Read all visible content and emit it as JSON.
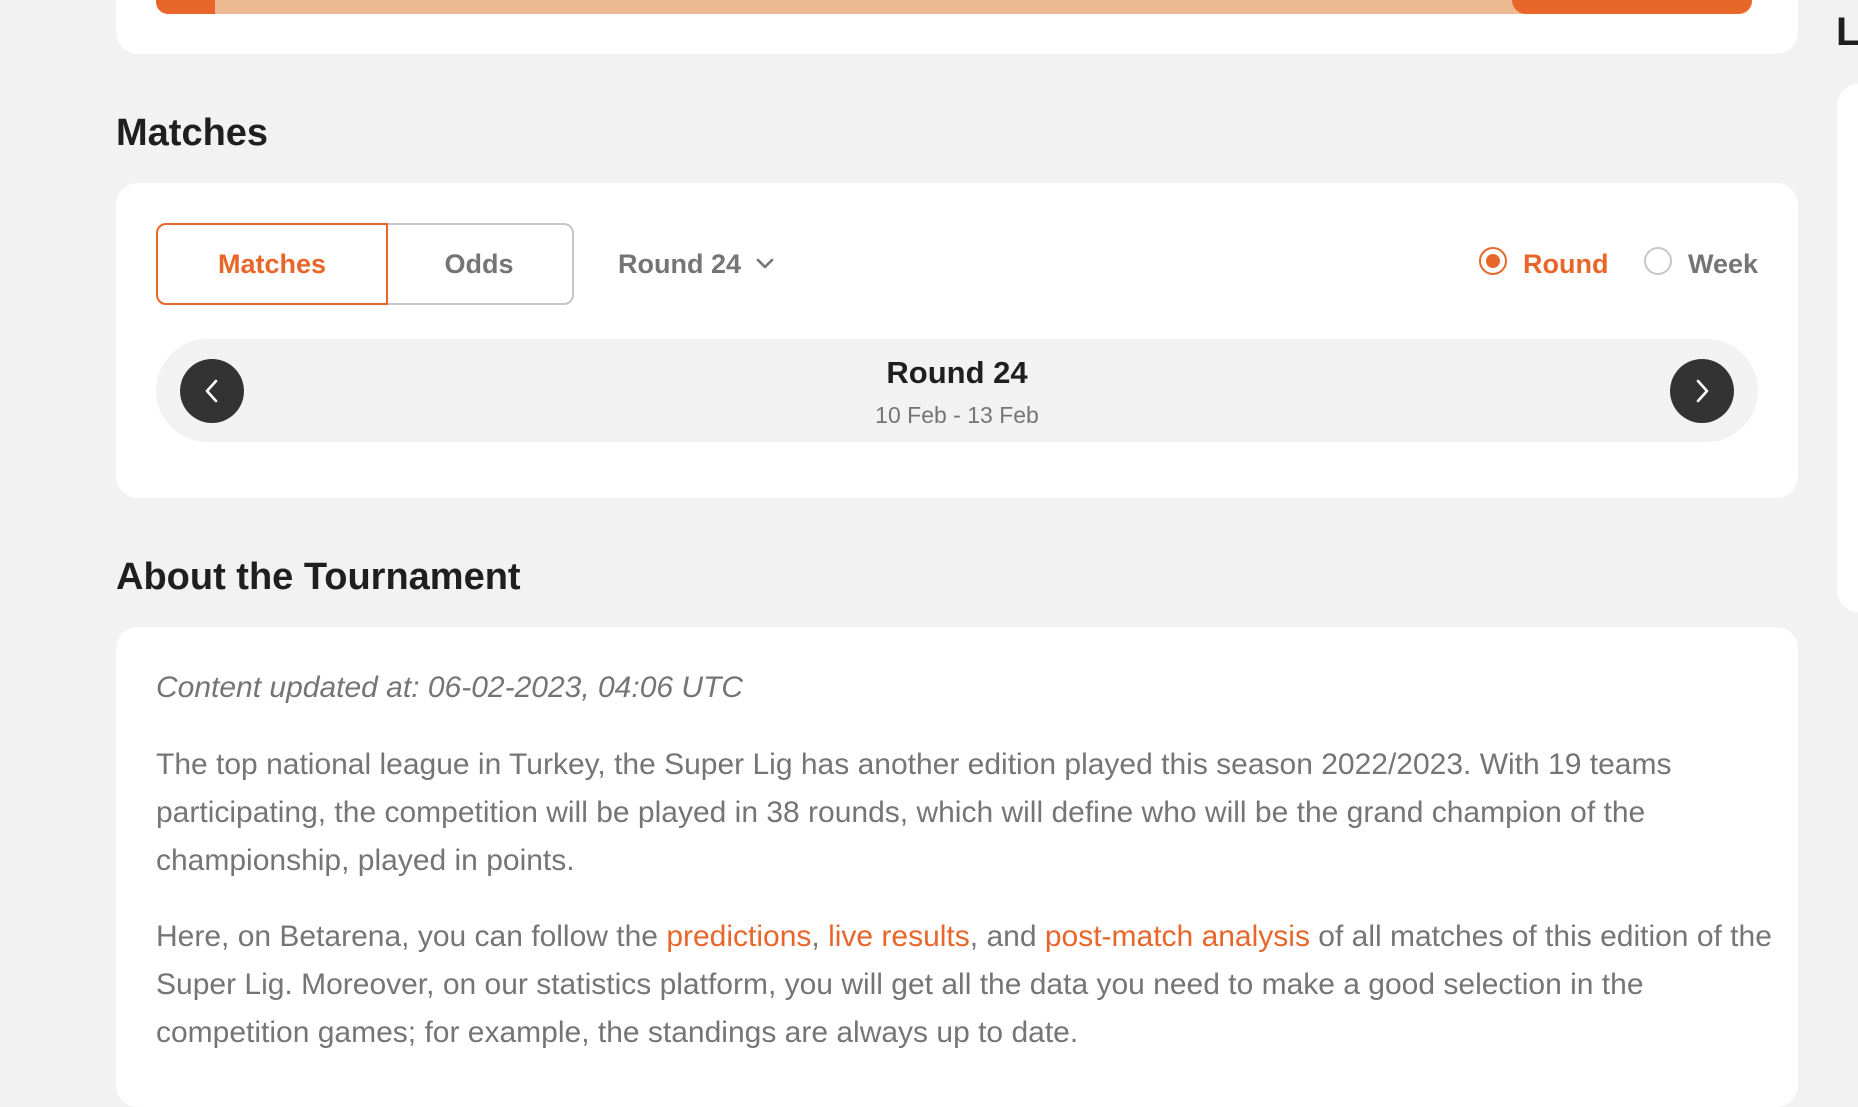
{
  "right_column": {
    "heading_partial": "L"
  },
  "sections": {
    "matches_title": "Matches",
    "about_title": "About the Tournament"
  },
  "matches": {
    "tabs": [
      {
        "label": "Matches",
        "active": true
      },
      {
        "label": "Odds",
        "active": false
      }
    ],
    "round_select": {
      "value": "Round 24"
    },
    "view_options": [
      {
        "label": "Round",
        "selected": true
      },
      {
        "label": "Week",
        "selected": false
      }
    ],
    "round_nav": {
      "title": "Round 24",
      "dates": "10 Feb - 13 Feb"
    }
  },
  "about": {
    "updated": "Content updated at: 06-02-2023, 04:06 UTC",
    "p1": "The top national league in Turkey, the Super Lig has another edition played this season 2022/2023. With 19 teams participating, the competition will be played in 38 rounds, which will define who will be the grand champion of the championship, played in points.",
    "p2_before": "Here, on Betarena, you can follow the ",
    "p2_link1": "predictions",
    "p2_sep1": ", ",
    "p2_link2": "live results",
    "p2_sep2": ", and ",
    "p2_link3": "post-match analysis",
    "p2_after": " of all matches of this edition of the Super Lig. Moreover, on our statistics platform, you will get all the data you need to make a good selection in the competition games; for example, the standings are always up to date."
  },
  "colors": {
    "accent": "#e8662a",
    "accent_light": "#ecb993",
    "background": "#f2f2f2",
    "card": "#ffffff",
    "muted_text": "#757575",
    "dark_button": "#333333"
  },
  "icons": {
    "round_select": "chevron-down-icon",
    "prev": "chevron-left-icon",
    "next": "chevron-right-icon"
  }
}
